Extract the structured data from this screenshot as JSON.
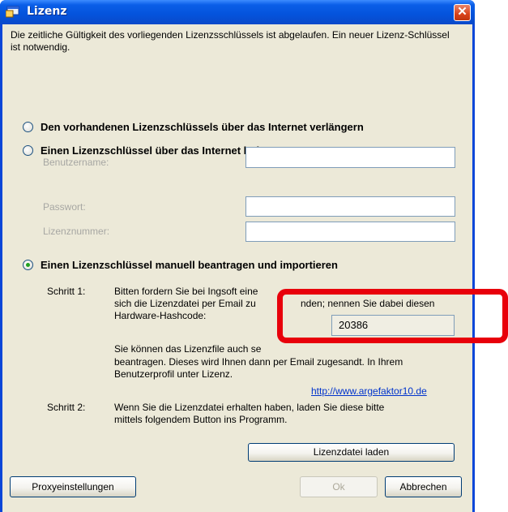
{
  "window": {
    "title": "Lizenz",
    "close_glyph": "✕"
  },
  "intro_text": "Die zeitliche Gültigkeit des vorliegenden Lizenzsschlüssels ist abgelaufen. Ein neuer Lizenz-Schlüssel ist notwendig.",
  "options": {
    "renew_label": "Den vorhandenen Lizenzschlüssels über das Internet verlängern",
    "fetch_label": "Einen Lizenzschlüssel über das Internet holen",
    "manual_label": "Einen Lizenzschlüssel manuell beantragen und importieren",
    "selected": "manual"
  },
  "fetch_form": {
    "username_label": "Benutzername:",
    "password_label": "Passwort:",
    "license_number_label": "Lizenznummer:"
  },
  "step1": {
    "label": "Schritt 1:",
    "line1": "Bitten fordern Sie bei Ingsoft eine",
    "line2": "sich die Lizenzdatei per Email zu",
    "line2b": "nden; nennen Sie dabei diesen",
    "line3": "Hardware-Hashcode:",
    "hashcode": "20386",
    "para2_line1": "Sie können das Lizenzfile auch se",
    "para2_line2": "beantragen. Dieses wird Ihnen dann per Email zugesandt. In Ihrem",
    "para2_line3": "Benutzerprofil unter Lizenz.",
    "link": "http://www.argefaktor10.de"
  },
  "step2": {
    "label": "Schritt 2:",
    "line1": "Wenn Sie die Lizenzdatei erhalten haben, laden Sie diese bitte",
    "line2": "mittels folgendem Button ins Programm."
  },
  "buttons": {
    "load_license": "Lizenzdatei laden",
    "proxy": "Proxyeinstellungen",
    "ok": "Ok",
    "cancel": "Abbrechen"
  },
  "colors": {
    "title_bar": "#0a5ee8",
    "dialog_bg": "#ece9d8",
    "highlight": "#e8000b",
    "link": "#0033cc"
  }
}
